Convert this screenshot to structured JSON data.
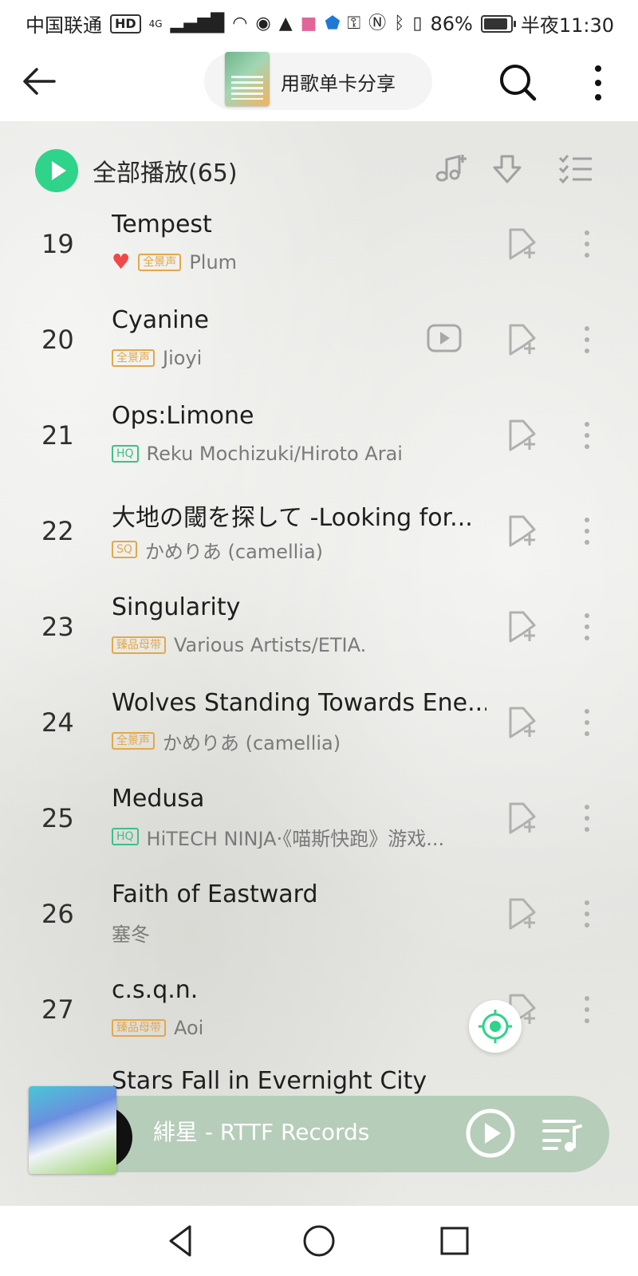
{
  "status_bar": {
    "carrier": "中国联通",
    "hd_badge": "HD",
    "network": "4G",
    "battery": "86%",
    "time": "半夜11:30"
  },
  "top_bar": {
    "share_label": "用歌单卡分享"
  },
  "list_header": {
    "play_all_label": "全部播放(65)"
  },
  "tracks": [
    {
      "num": "19",
      "title": "Tempest",
      "liked": true,
      "badge": "全景声",
      "badge_color": "#e2a84a",
      "artist": "Plum",
      "has_video": false
    },
    {
      "num": "20",
      "title": "Cyanine",
      "liked": false,
      "badge": "全景声",
      "badge_color": "#e2a84a",
      "artist": "Jioyi",
      "has_video": true
    },
    {
      "num": "21",
      "title": "Ops:Limone",
      "liked": false,
      "badge": "HQ",
      "badge_color": "#3cc08a",
      "artist": "Reku Mochizuki/Hiroto Arai",
      "has_video": false
    },
    {
      "num": "22",
      "title": "大地の閾を探して -Looking for...",
      "liked": false,
      "badge": "SQ",
      "badge_color": "#e2a84a",
      "artist": "かめりあ (camellia)",
      "has_video": false
    },
    {
      "num": "23",
      "title": "Singularity",
      "liked": false,
      "badge": "臻品母带",
      "badge_color": "#e2a84a",
      "artist": "Various Artists/ETIA.",
      "has_video": false
    },
    {
      "num": "24",
      "title": "Wolves Standing Towards Ene...",
      "liked": false,
      "badge": "全景声",
      "badge_color": "#e2a84a",
      "artist": "かめりあ (camellia)",
      "has_video": false
    },
    {
      "num": "25",
      "title": "Medusa",
      "liked": false,
      "badge": "HQ",
      "badge_color": "#3cc08a",
      "artist": "HiTECH NINJA·《喵斯快跑》游戏...",
      "has_video": false
    },
    {
      "num": "26",
      "title": "Faith of Eastward",
      "liked": false,
      "badge": "",
      "badge_color": "",
      "artist": "塞冬",
      "has_video": false
    },
    {
      "num": "27",
      "title": "c.s.q.n.",
      "liked": false,
      "badge": "臻品母带",
      "badge_color": "#e2a84a",
      "artist": "Aoi",
      "has_video": false
    }
  ],
  "peek_track": {
    "title": "Stars Fall in Evernight City"
  },
  "mini_player": {
    "now_playing": "緋星 - RTTF Records"
  },
  "colors": {
    "accent_green": "#2fd38a",
    "heart_red": "#f04848",
    "badge_gold": "#e2a84a",
    "badge_green": "#3cc08a",
    "player_bar": "#b6cdb9"
  }
}
